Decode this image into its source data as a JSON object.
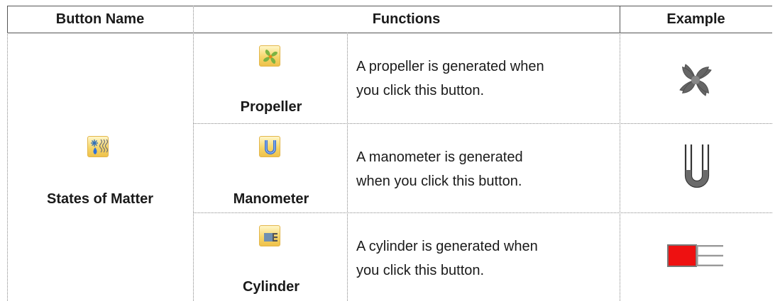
{
  "header": {
    "button_name": "Button Name",
    "functions": "Functions",
    "example": "Example"
  },
  "group": {
    "label": "States of Matter",
    "icon": "states-of-matter-icon"
  },
  "rows": [
    {
      "label": "Propeller",
      "icon": "propeller-button-icon",
      "line1": "A propeller is generated when",
      "line2": "you click this button.",
      "example_icon": "propeller-example-icon"
    },
    {
      "label": "Manometer",
      "icon": "manometer-button-icon",
      "line1": "A manometer is generated",
      "line2": "when you click this button.",
      "example_icon": "manometer-example-icon"
    },
    {
      "label": "Cylinder",
      "icon": "cylinder-button-icon",
      "line1": "A cylinder is generated when",
      "line2": "you click this button.",
      "example_icon": "cylinder-example-icon"
    }
  ],
  "colors": {
    "propeller_green": "#7cb342",
    "manometer_blue": "#3b6fd0",
    "cylinder_red": "#ee1111"
  }
}
